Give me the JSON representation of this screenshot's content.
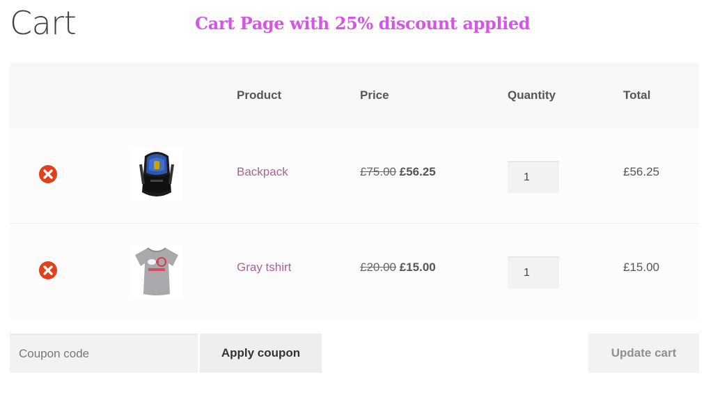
{
  "page": {
    "title": "Cart",
    "banner": "Cart Page with 25% discount applied"
  },
  "table": {
    "headers": {
      "product": "Product",
      "price": "Price",
      "quantity": "Quantity",
      "total": "Total"
    },
    "rows": [
      {
        "name": "Backpack",
        "old_price": "£75.00",
        "new_price": "£56.25",
        "quantity": "1",
        "total": "£56.25",
        "thumbnail_icon": "backpack-image"
      },
      {
        "name": "Gray tshirt",
        "old_price": "£20.00",
        "new_price": "£15.00",
        "quantity": "1",
        "total": "£15.00",
        "thumbnail_icon": "tshirt-image"
      }
    ]
  },
  "actions": {
    "coupon_placeholder": "Coupon code",
    "apply_label": "Apply coupon",
    "update_label": "Update cart"
  },
  "colors": {
    "banner": "#d455e6",
    "link": "#a46497",
    "remove_icon": "#e2401c"
  }
}
